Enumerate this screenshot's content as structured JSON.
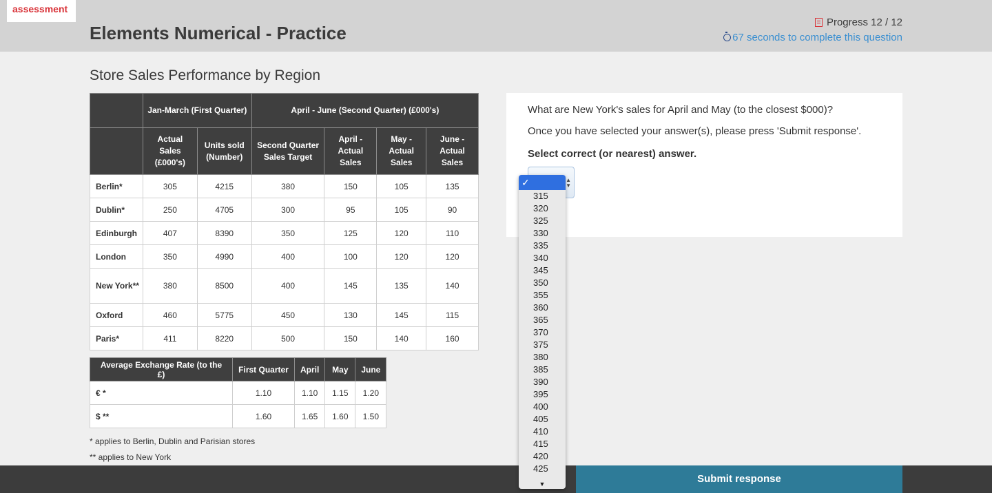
{
  "header": {
    "logo_text": "assessment",
    "title": "Elements Numerical - Practice",
    "progress": "Progress 12 / 12",
    "timer": "67 seconds to complete this question"
  },
  "section_title": "Store Sales Performance by Region",
  "sales_table": {
    "group_headers": [
      "Jan-March (First Quarter)",
      "April - June (Second Quarter) (£000's)"
    ],
    "columns": [
      "Actual Sales (£000's)",
      "Units sold (Number)",
      "Second Quarter Sales Target",
      "April - Actual Sales",
      "May - Actual Sales",
      "June - Actual Sales"
    ],
    "rows": [
      {
        "region": "Berlin*",
        "values": [
          "305",
          "4215",
          "380",
          "150",
          "105",
          "135"
        ]
      },
      {
        "region": "Dublin*",
        "values": [
          "250",
          "4705",
          "300",
          "95",
          "105",
          "90"
        ]
      },
      {
        "region": "Edinburgh",
        "values": [
          "407",
          "8390",
          "350",
          "125",
          "120",
          "110"
        ]
      },
      {
        "region": "London",
        "values": [
          "350",
          "4990",
          "400",
          "100",
          "120",
          "120"
        ]
      },
      {
        "region": "New York**",
        "values": [
          "380",
          "8500",
          "400",
          "145",
          "135",
          "140"
        ]
      },
      {
        "region": "Oxford",
        "values": [
          "460",
          "5775",
          "450",
          "130",
          "145",
          "115"
        ]
      },
      {
        "region": "Paris*",
        "values": [
          "411",
          "8220",
          "500",
          "150",
          "140",
          "160"
        ]
      }
    ]
  },
  "fx_table": {
    "headers": [
      "Average Exchange Rate (to the £)",
      "First Quarter",
      "April",
      "May",
      "June"
    ],
    "rows": [
      {
        "currency": "€ *",
        "values": [
          "1.10",
          "1.10",
          "1.15",
          "1.20"
        ]
      },
      {
        "currency": "$ **",
        "values": [
          "1.60",
          "1.65",
          "1.60",
          "1.50"
        ]
      }
    ]
  },
  "notes": [
    "* applies to Berlin, Dublin and Parisian stores",
    "** applies to New York"
  ],
  "question": {
    "text": "What are New York's sales for April and May (to the closest $000)?",
    "instruction": "Once you have selected your answer(s), please press 'Submit response'.",
    "prompt": "Select correct (or nearest) answer."
  },
  "dropdown": {
    "selected_mark": "✓",
    "options": [
      "315",
      "320",
      "325",
      "330",
      "335",
      "340",
      "345",
      "350",
      "355",
      "360",
      "365",
      "370",
      "375",
      "380",
      "385",
      "390",
      "395",
      "400",
      "405",
      "410",
      "415",
      "420",
      "425"
    ],
    "more_indicator": "▼"
  },
  "submit_label": "Submit response"
}
